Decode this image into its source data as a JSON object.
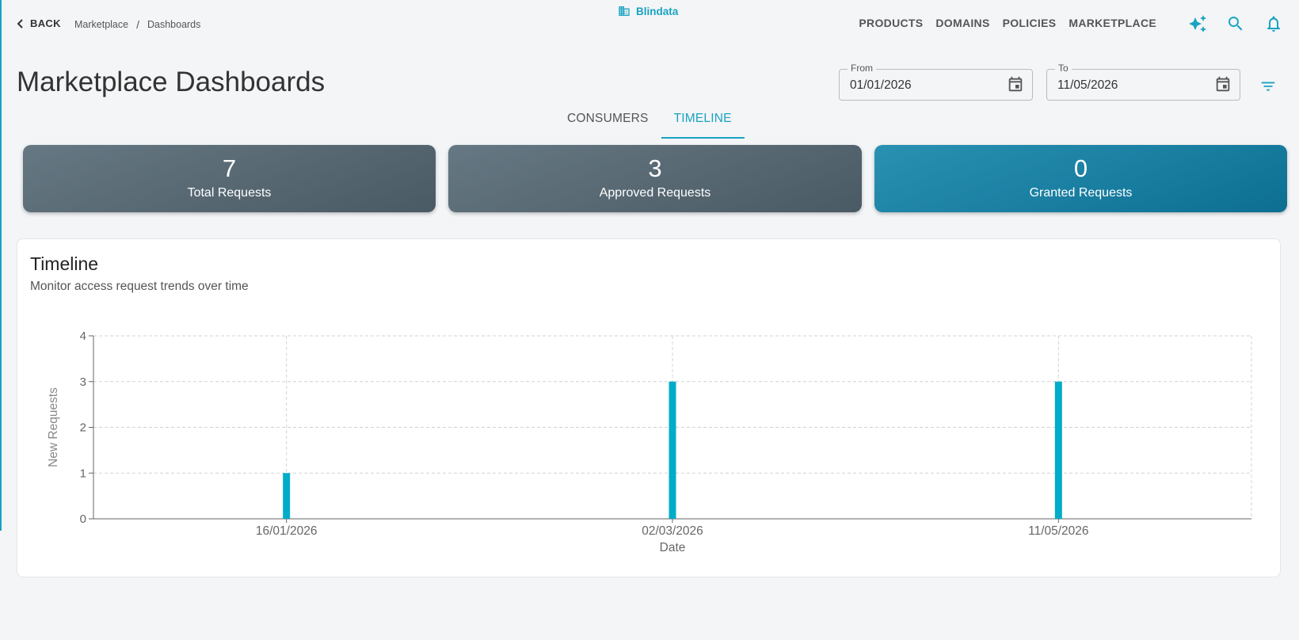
{
  "colors": {
    "accent": "#1aa3c1",
    "bar": "#00acc9",
    "card_gray": "#56666f",
    "card_teal": "#1683a6"
  },
  "topbar": {
    "back_label": "BACK",
    "breadcrumb": [
      "Marketplace",
      "Dashboards"
    ],
    "brand": "Blindata",
    "nav": [
      "PRODUCTS",
      "DOMAINS",
      "POLICIES",
      "MARKETPLACE"
    ],
    "icons": [
      "sparkle-icon",
      "search-icon",
      "bell-icon"
    ]
  },
  "header": {
    "title": "Marketplace Dashboards",
    "from_label": "From",
    "from_value": "01/01/2026",
    "to_label": "To",
    "to_value": "11/05/2026"
  },
  "tabs": [
    {
      "label": "CONSUMERS",
      "active": false
    },
    {
      "label": "TIMELINE",
      "active": true
    }
  ],
  "stats": [
    {
      "value": "7",
      "label": "Total Requests"
    },
    {
      "value": "3",
      "label": "Approved Requests"
    },
    {
      "value": "0",
      "label": "Granted Requests"
    }
  ],
  "panel": {
    "title": "Timeline",
    "subtitle": "Monitor access request trends over time"
  },
  "chart_data": {
    "type": "bar",
    "categories": [
      "16/01/2026",
      "02/03/2026",
      "11/05/2026"
    ],
    "values": [
      1,
      3,
      3
    ],
    "xlabel": "Date",
    "ylabel": "New Requests",
    "ylim": [
      0,
      4
    ],
    "yticks": [
      0,
      1,
      2,
      3,
      4
    ],
    "grid": true
  }
}
